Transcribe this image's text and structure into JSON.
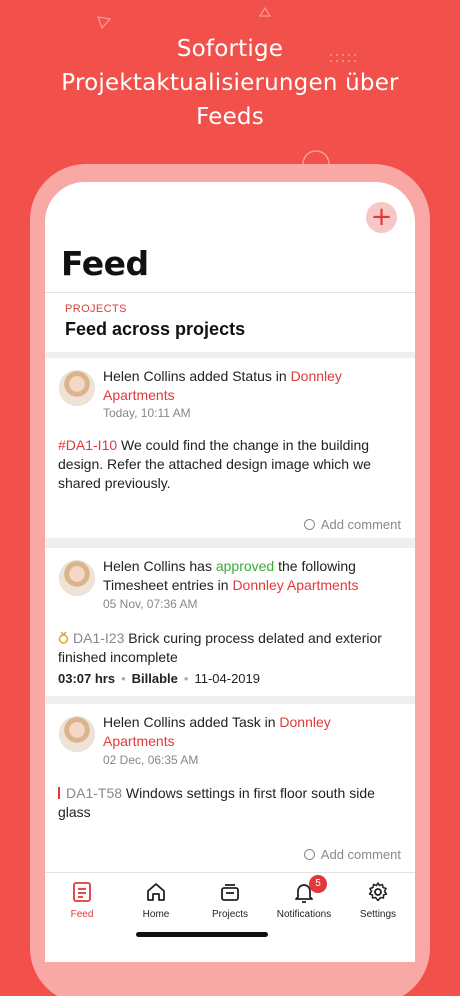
{
  "headline": {
    "line1": "Sofortige",
    "line2": "Projektaktualisierungen über",
    "line3": "Feeds"
  },
  "header": {
    "title": "Feed",
    "add_icon": "plus-icon"
  },
  "projects": {
    "label": "PROJECTS",
    "subtitle": "Feed across projects"
  },
  "cards": [
    {
      "author": "Helen Collins",
      "action": " added Status in ",
      "project": "Donnley Apartments",
      "time": "Today, 10:11 AM",
      "tag": "#DA1-I10",
      "text": "  We could find the change in the building design. Refer the attached design image which we shared previously.",
      "comment": "Add comment"
    },
    {
      "author": "Helen Collins",
      "action_pre": "  has ",
      "status": "approved",
      "action_post": " the following Timesheet entries in ",
      "project": "Donnley Apartments",
      "time": "05 Nov, 07:36 AM",
      "tag": "DA1-I23",
      "text": "  Brick curing process delated and exterior finished incomplete",
      "hours": "03:07 hrs",
      "billable": "Billable",
      "date": "11-04-2019"
    },
    {
      "author": "Helen Collins",
      "action": " added Task in ",
      "project": "Donnley Apartments",
      "time": "02 Dec, 06:35 AM",
      "tag": "DA1-T58",
      "text": "  Windows settings in first floor south side glass",
      "comment": "Add comment"
    }
  ],
  "nav": {
    "items": [
      {
        "label": "Feed",
        "icon": "feed-icon"
      },
      {
        "label": "Home",
        "icon": "home-icon"
      },
      {
        "label": "Projects",
        "icon": "projects-icon"
      },
      {
        "label": "Notifications",
        "icon": "bell-icon",
        "badge": "5"
      },
      {
        "label": "Settings",
        "icon": "gear-icon"
      }
    ]
  },
  "colors": {
    "background": "#F2514B",
    "accent": "#E0393A",
    "approved": "#3BAA35"
  }
}
